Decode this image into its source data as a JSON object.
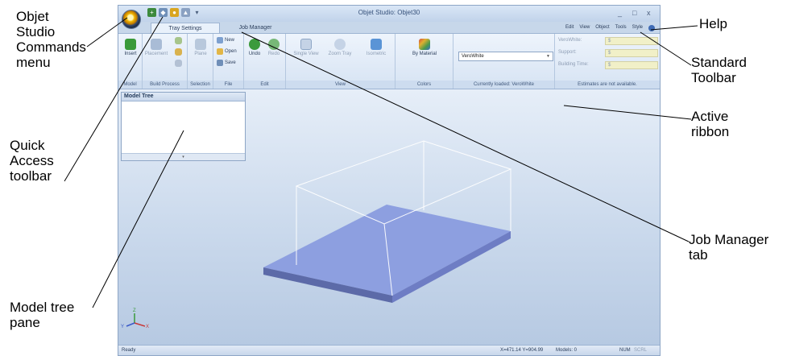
{
  "callouts": {
    "commands_menu": [
      "Objet",
      "Studio",
      "Commands",
      "menu"
    ],
    "quick_access": [
      "Quick",
      "Access",
      "toolbar"
    ],
    "model_tree": [
      "Model tree",
      "pane"
    ],
    "help": "Help",
    "standard_toolbar": [
      "Standard",
      "Toolbar"
    ],
    "active_ribbon": [
      "Active",
      "ribbon"
    ],
    "job_manager_tab": [
      "Job Manager",
      "tab"
    ]
  },
  "window": {
    "title": "Objet Studio: Objet30",
    "minimize": "_",
    "maximize": "□",
    "close": "x"
  },
  "tabs": [
    {
      "label": "Tray Settings",
      "active": true
    },
    {
      "label": "Job Manager",
      "active": false
    }
  ],
  "standard_toolbar": {
    "items": [
      "Edit",
      "View",
      "Object",
      "Tools",
      "Style"
    ]
  },
  "ribbon": {
    "groups": {
      "model": {
        "label": "Model",
        "insert": "Insert"
      },
      "build_process": {
        "label": "Build Process",
        "placement": "Placement"
      },
      "selection": {
        "label": "Selection",
        "plane": "Plane"
      },
      "file": {
        "label": "File",
        "new": "New",
        "open": "Open",
        "save": "Save"
      },
      "edit": {
        "label": "Edit",
        "undo": "Undo",
        "redo": "Redo"
      },
      "view": {
        "label": "View",
        "single_view": "Single View",
        "zoom_tray": "Zoom Tray",
        "isometric": "Isometric"
      },
      "colors": {
        "label": "Colors",
        "by_material": "By Material"
      },
      "material": {
        "label": "Currently loaded: VeroWhite",
        "selected": "VeroWhite"
      },
      "estimates": {
        "label": "Estimates are not available.",
        "rows": [
          {
            "name": "VeroWhite:",
            "value": "$"
          },
          {
            "name": "Support:",
            "value": "$"
          },
          {
            "name": "Building Time:",
            "value": "$"
          }
        ]
      }
    }
  },
  "model_tree": {
    "title": "Model Tree"
  },
  "status_bar": {
    "ready": "Ready",
    "coords": "X=471.14 Y=904.99",
    "models": "Models: 0",
    "num": "NUM",
    "scrl": "SCRL"
  },
  "icons": {
    "orb": "objet-studio-orb-icon",
    "axes": "xyz-axes-icon",
    "help": "help-icon"
  }
}
